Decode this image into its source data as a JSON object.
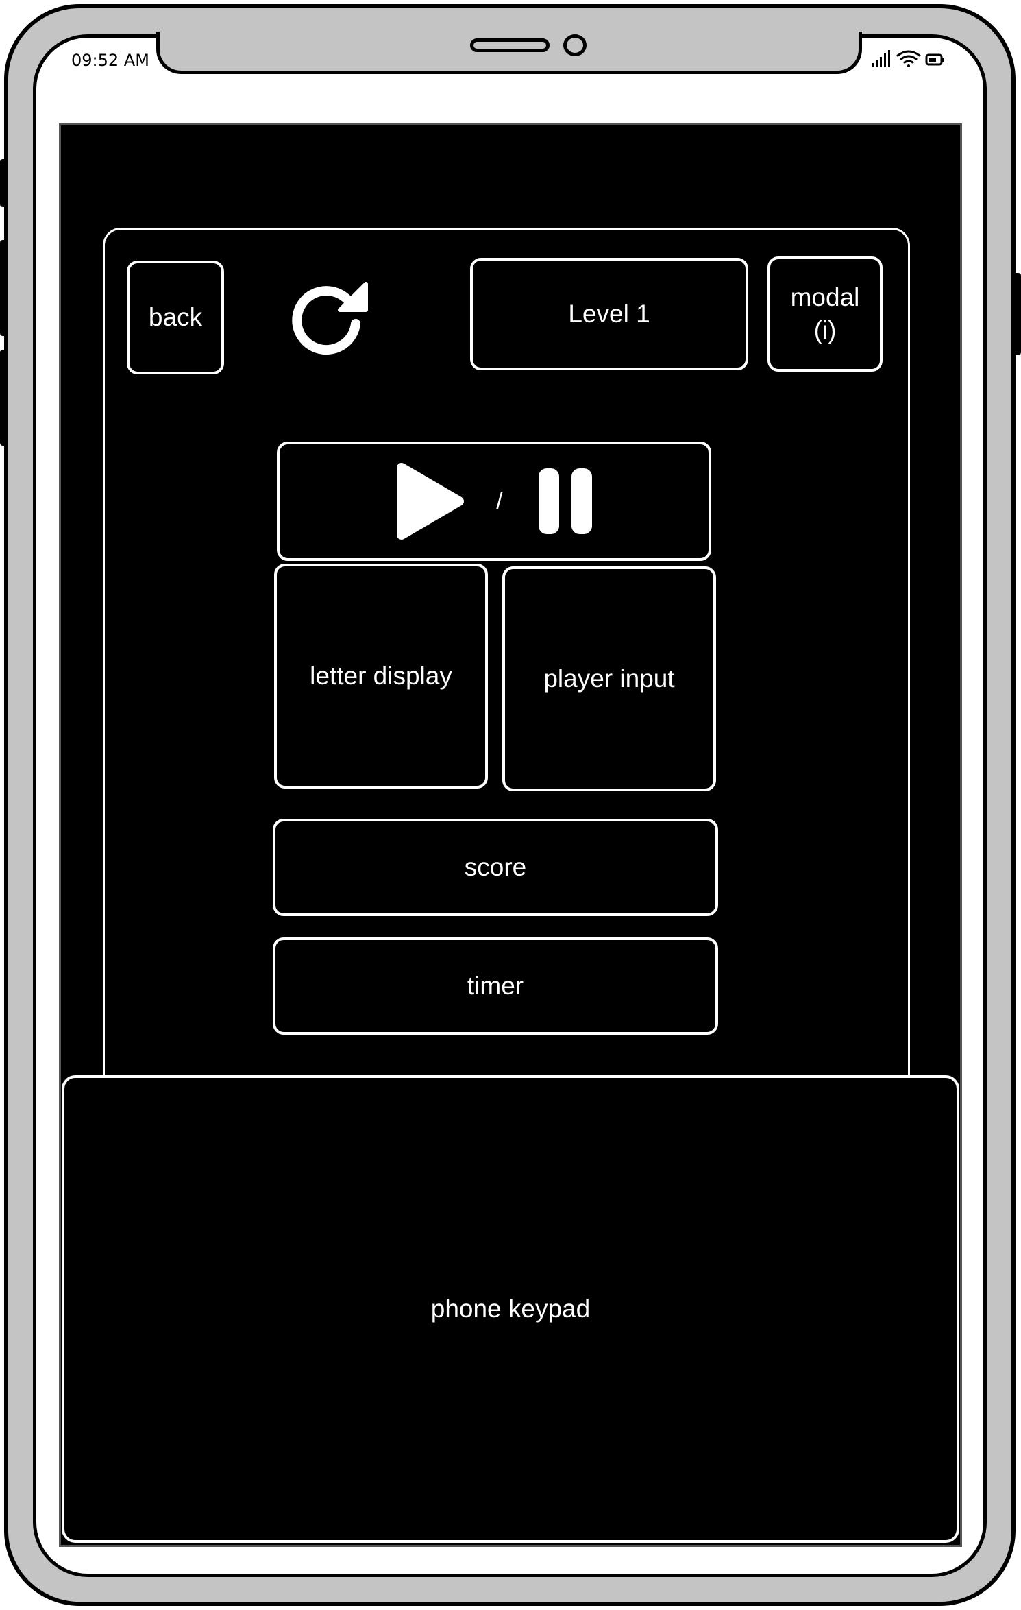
{
  "status_bar": {
    "time": "09:52 AM"
  },
  "header": {
    "back_label": "back",
    "restart_icon": "restart-icon",
    "level_label": "Level 1",
    "modal_label": "modal\n(i)"
  },
  "controls": {
    "play_icon": "play-icon",
    "separator": "/",
    "pause_icon": "pause-icon"
  },
  "game": {
    "letter_display_label": "letter display",
    "player_input_label": "player input",
    "score_label": "score",
    "timer_label": "timer"
  },
  "keypad": {
    "label": "phone keypad"
  },
  "colors": {
    "screen_background": "#000000",
    "foreground": "#ffffff",
    "frame": "#c4c4c4"
  }
}
